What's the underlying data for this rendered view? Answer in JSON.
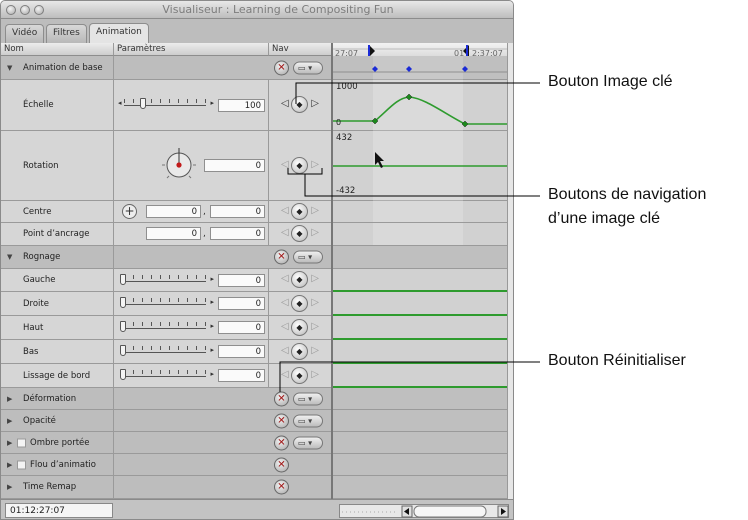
{
  "window": {
    "title": "Visualiseur : Learning de Compositing Fun"
  },
  "tabs": [
    {
      "label": "Vidéo"
    },
    {
      "label": "Filtres"
    },
    {
      "label": "Animation"
    }
  ],
  "columns": {
    "name": "Nom",
    "params": "Paramètres",
    "nav": "Nav"
  },
  "timeline": {
    "start_tc": "27:07",
    "end_tc_a": "01",
    "end_tc_b": "2:37:07",
    "scale_label": "1000",
    "rot_top": "432",
    "rot_bottom": "-432"
  },
  "rows": {
    "anim_base": {
      "label": "Animation de base"
    },
    "echelle": {
      "label": "Échelle",
      "value": "100"
    },
    "rotation": {
      "label": "Rotation",
      "value": "0"
    },
    "centre": {
      "label": "Centre",
      "x": "0",
      "y": "0"
    },
    "ancrage": {
      "label": "Point d’ancrage",
      "x": "0",
      "y": "0"
    },
    "rognage": {
      "label": "Rognage"
    },
    "gauche": {
      "label": "Gauche",
      "value": "0"
    },
    "droite": {
      "label": "Droite",
      "value": "0"
    },
    "haut": {
      "label": "Haut",
      "value": "0"
    },
    "bas": {
      "label": "Bas",
      "value": "0"
    },
    "lissage": {
      "label": "Lissage de bord",
      "value": "0"
    },
    "deformation": {
      "label": "Déformation"
    },
    "opacite": {
      "label": "Opacité"
    },
    "ombre": {
      "label": "Ombre portée"
    },
    "flou": {
      "label": "Flou d’animatio"
    },
    "remap": {
      "label": "Time Remap"
    }
  },
  "status": {
    "timecode": "01:12:27:07"
  },
  "callouts": {
    "keyframe_button": "Bouton Image clé",
    "nav_buttons_line1": "Boutons de navigation",
    "nav_buttons_line2": "d’une image clé",
    "reset_button": "Bouton Réinitialiser"
  },
  "colors": {
    "curve": "#2e9b2e",
    "keyframe_marker": "#1b2bd6",
    "reset_x": "#a01515"
  },
  "icons": {
    "reset": "reset-x-icon",
    "keyframe": "keyframe-diamond-icon",
    "menu": "parameter-menu-icon"
  }
}
